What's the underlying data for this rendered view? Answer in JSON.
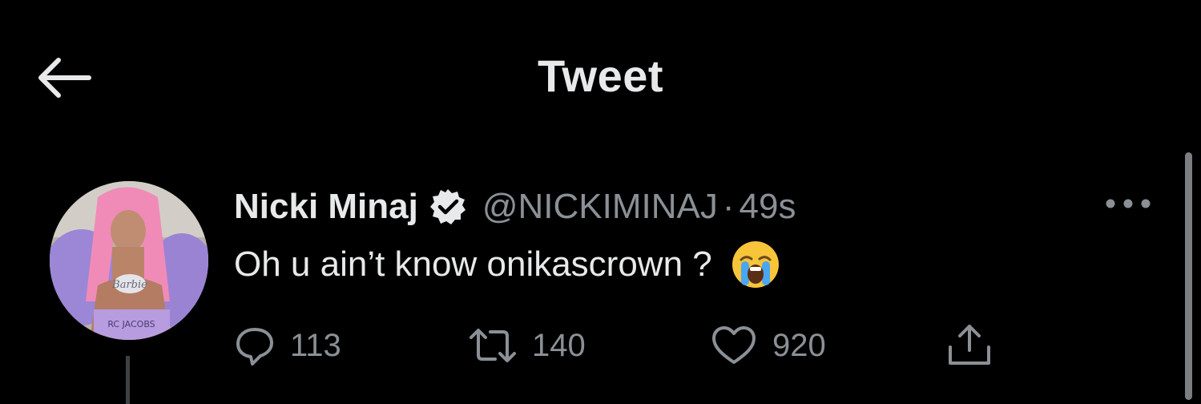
{
  "header": {
    "title": "Tweet",
    "back_icon": "arrow-left-icon"
  },
  "tweet": {
    "display_name": "Nicki Minaj",
    "verified_icon": "verified-badge-icon",
    "handle": "@NICKIMINAJ",
    "separator": "·",
    "time": "49s",
    "text": "Oh u ain’t know onikascrown ?",
    "emoji": "loudly-crying-face-emoji",
    "more_icon": "more-dots-icon",
    "avatar": {
      "caption_necklace": "Barbie",
      "caption_shirt": "RC JACOBS"
    },
    "actions": {
      "reply_count": "113",
      "retweet_count": "140",
      "like_count": "920"
    }
  },
  "colors": {
    "background": "#000000",
    "primary_text": "#e7e9ea",
    "secondary_text": "#8b9096"
  }
}
